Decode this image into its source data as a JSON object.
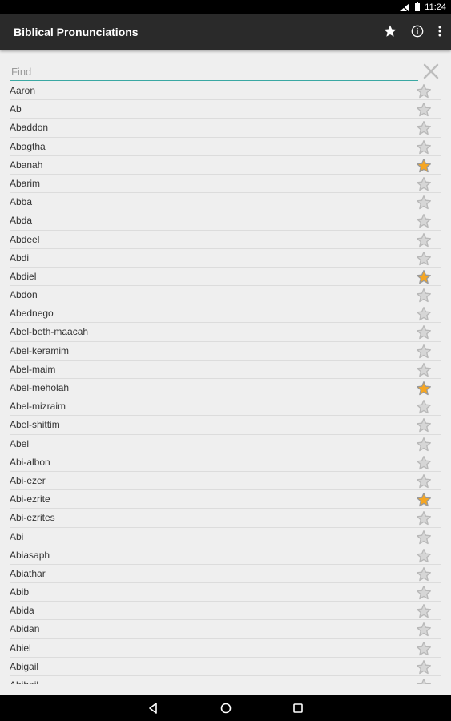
{
  "status": {
    "time": "11:24"
  },
  "app": {
    "title": "Biblical Pronunciations"
  },
  "search": {
    "placeholder": "Find",
    "value": ""
  },
  "names": [
    {
      "name": "Aaron",
      "fav": false
    },
    {
      "name": "Ab",
      "fav": false
    },
    {
      "name": "Abaddon",
      "fav": false
    },
    {
      "name": "Abagtha",
      "fav": false
    },
    {
      "name": "Abanah",
      "fav": true
    },
    {
      "name": "Abarim",
      "fav": false
    },
    {
      "name": "Abba",
      "fav": false
    },
    {
      "name": "Abda",
      "fav": false
    },
    {
      "name": "Abdeel",
      "fav": false
    },
    {
      "name": "Abdi",
      "fav": false
    },
    {
      "name": "Abdiel",
      "fav": true
    },
    {
      "name": "Abdon",
      "fav": false
    },
    {
      "name": "Abednego",
      "fav": false
    },
    {
      "name": "Abel-beth-maacah",
      "fav": false
    },
    {
      "name": "Abel-keramim",
      "fav": false
    },
    {
      "name": "Abel-maim",
      "fav": false
    },
    {
      "name": "Abel-meholah",
      "fav": true
    },
    {
      "name": "Abel-mizraim",
      "fav": false
    },
    {
      "name": "Abel-shittim",
      "fav": false
    },
    {
      "name": "Abel",
      "fav": false
    },
    {
      "name": "Abi-albon",
      "fav": false
    },
    {
      "name": "Abi-ezer",
      "fav": false
    },
    {
      "name": "Abi-ezrite",
      "fav": true
    },
    {
      "name": "Abi-ezrites",
      "fav": false
    },
    {
      "name": "Abi",
      "fav": false
    },
    {
      "name": "Abiasaph",
      "fav": false
    },
    {
      "name": "Abiathar",
      "fav": false
    },
    {
      "name": "Abib",
      "fav": false
    },
    {
      "name": "Abida",
      "fav": false
    },
    {
      "name": "Abidan",
      "fav": false
    },
    {
      "name": "Abiel",
      "fav": false
    },
    {
      "name": "Abigail",
      "fav": false
    },
    {
      "name": "Abihail",
      "fav": false
    }
  ],
  "colors": {
    "accent": "#3aa8a3",
    "star_on": "#f5a623",
    "star_off": "#b9b9b9"
  },
  "icons": {
    "favorites": "star-icon",
    "info": "info-icon",
    "menu": "overflow-menu-icon",
    "clear": "close-icon",
    "back": "back-icon",
    "home": "home-icon",
    "recents": "recents-icon"
  }
}
